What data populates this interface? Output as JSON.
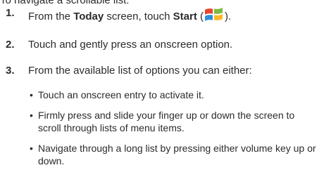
{
  "intro": "To navigate a scrollable list:",
  "steps": [
    {
      "number": "1.",
      "prefix": "From the ",
      "bold1": "Today",
      "middle": " screen, touch ",
      "bold2": "Start",
      "suffix_open": " (",
      "icon": "windows-start-icon",
      "suffix_close": ")."
    },
    {
      "number": "2.",
      "text": "Touch and gently press an onscreen option."
    },
    {
      "number": "3.",
      "text": "From the available list of options you can either:"
    }
  ],
  "bullets": [
    "Touch an onscreen entry to activate it.",
    "Firmly press and slide your finger up or down the screen to scroll through lists of menu items.",
    "Navigate through a long list by pressing either volume key up or down."
  ],
  "bullet_glyph": "•",
  "colors": {
    "text": "#2b2b2b",
    "logo_red": "#e8452c",
    "logo_green": "#7cbb42",
    "logo_blue": "#2f8fd8",
    "logo_yellow": "#f7b928"
  }
}
